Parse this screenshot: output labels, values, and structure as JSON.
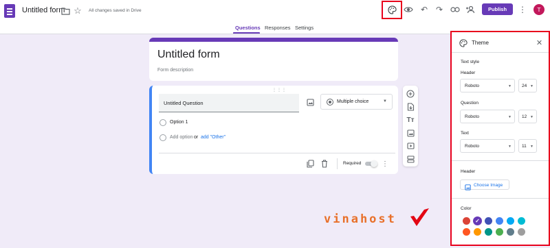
{
  "header": {
    "form_title": "Untitled form",
    "save_status": "All changes saved in Drive",
    "publish_label": "Publish",
    "avatar_initial": "T"
  },
  "tabs": [
    {
      "label": "Questions",
      "active": true
    },
    {
      "label": "Responses",
      "active": false
    },
    {
      "label": "Settings",
      "active": false
    }
  ],
  "form": {
    "title": "Untitled form",
    "description_placeholder": "Form description"
  },
  "question": {
    "title": "Untitled Question",
    "type": "Multiple choice",
    "option_1": "Option 1",
    "add_option": "Add option",
    "or_text": "or",
    "add_other": "add \"Other\"",
    "required_label": "Required",
    "required": false
  },
  "toolbar_icons": [
    "add-question-icon",
    "import-questions-icon",
    "add-title-icon",
    "add-image-icon",
    "add-video-icon",
    "add-section-icon"
  ],
  "theme_panel": {
    "title": "Theme",
    "text_style_heading": "Text style",
    "header_label": "Header",
    "header_font": "Roboto",
    "header_size": "24",
    "question_label": "Question",
    "question_font": "Roboto",
    "question_size": "12",
    "text_label": "Text",
    "text_font": "Roboto",
    "text_size": "11",
    "header_section_heading": "Header",
    "choose_image_label": "Choose Image",
    "color_heading": "Color",
    "colors_row1": [
      "#db4437",
      "#673ab7",
      "#3f51b5",
      "#4285f4",
      "#03a9f4",
      "#00bcd4"
    ],
    "colors_row2": [
      "#ff5722",
      "#ff9800",
      "#009688",
      "#4caf50",
      "#607d8b",
      "#9e9e9e"
    ],
    "selected_color": "#673ab7"
  },
  "watermark": {
    "text": "vinahost"
  },
  "colors": {
    "accent": "#673ab7",
    "highlight": "#e8001c",
    "link": "#1a73e8"
  }
}
